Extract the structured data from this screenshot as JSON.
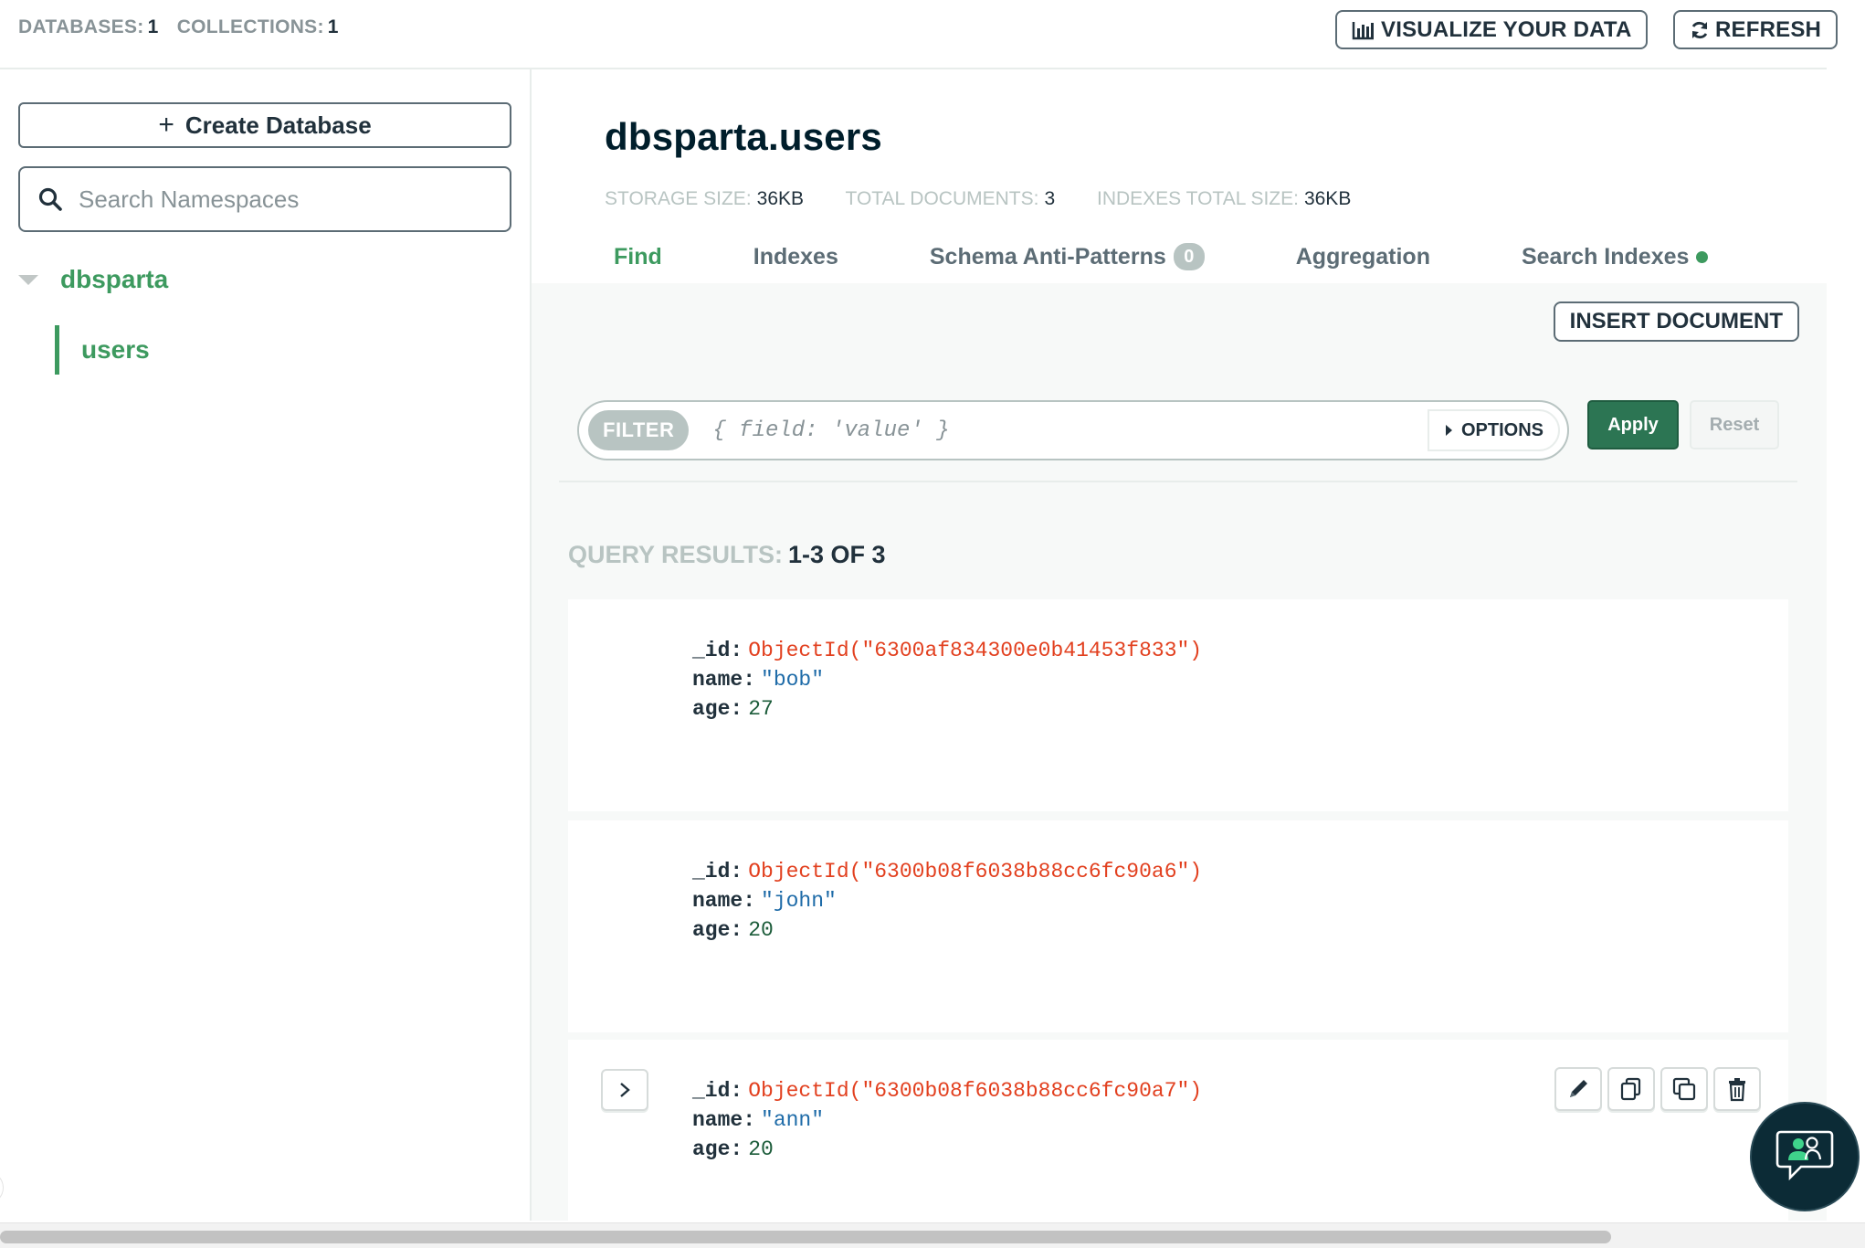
{
  "topbar": {
    "databases_label": "DATABASES:",
    "databases_count": "1",
    "collections_label": "COLLECTIONS:",
    "collections_count": "1",
    "visualize_label": "VISUALIZE YOUR DATA",
    "refresh_label": "REFRESH"
  },
  "sidebar": {
    "create_db_label": "Create Database",
    "search_placeholder": "Search Namespaces",
    "database": "dbsparta",
    "collection": "users"
  },
  "collection": {
    "title": "dbsparta.users",
    "storage_size_label": "STORAGE SIZE:",
    "storage_size": "36KB",
    "total_docs_label": "TOTAL DOCUMENTS:",
    "total_docs": "3",
    "indexes_size_label": "INDEXES TOTAL SIZE:",
    "indexes_size": "36KB"
  },
  "tabs": [
    {
      "label": "Find",
      "active": true
    },
    {
      "label": "Indexes"
    },
    {
      "label": "Schema Anti-Patterns",
      "badge": "0"
    },
    {
      "label": "Aggregation"
    },
    {
      "label": "Search Indexes",
      "status_dot_color": "#3d9a5f"
    }
  ],
  "toolbar": {
    "insert_label": "INSERT DOCUMENT",
    "filter_label": "FILTER",
    "filter_placeholder": "{ field: 'value' }",
    "options_label": "OPTIONS",
    "apply_label": "Apply",
    "reset_label": "Reset"
  },
  "results": {
    "label": "QUERY RESULTS:",
    "range": "1-3 OF 3"
  },
  "documents": [
    {
      "id_key": "_id:",
      "id": "ObjectId(\"6300af834300e0b41453f833\")",
      "name_key": "name:",
      "name": "\"bob\"",
      "age_key": "age:",
      "age": "27"
    },
    {
      "id_key": "_id:",
      "id": "ObjectId(\"6300b08f6038b88cc6fc90a6\")",
      "name_key": "name:",
      "name": "\"john\"",
      "age_key": "age:",
      "age": "20"
    },
    {
      "id_key": "_id:",
      "id": "ObjectId(\"6300b08f6038b88cc6fc90a7\")",
      "name_key": "name:",
      "name": "\"ann\"",
      "age_key": "age:",
      "age": "20"
    }
  ],
  "colors": {
    "accent_green": "#3d9a5f",
    "apply_green": "#2c7553",
    "objectid_red": "#e2401f",
    "string_blue": "#1e6ba8"
  },
  "icons": [
    "bar-chart-icon",
    "refresh-icon",
    "search-icon",
    "caret-down-icon",
    "chevron-right-icon",
    "edit-icon",
    "copy-icon",
    "clone-icon",
    "trash-icon",
    "chat-help-icon"
  ]
}
